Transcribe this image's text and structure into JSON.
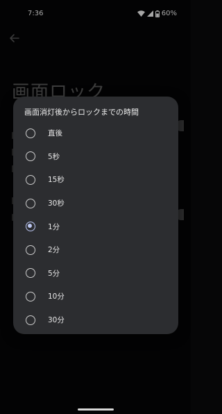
{
  "status_bar": {
    "time": "7:36",
    "battery": "60%",
    "icons": [
      "wifi-icon",
      "cell-signal-icon",
      "battery-icon"
    ]
  },
  "page": {
    "back_icon": "arrow-left-icon",
    "title": "画面ロック"
  },
  "dialog": {
    "title": "画面消灯後からロックまでの時間",
    "options": [
      {
        "label": "直後",
        "selected": false
      },
      {
        "label": "5秒",
        "selected": false
      },
      {
        "label": "15秒",
        "selected": false
      },
      {
        "label": "30秒",
        "selected": false
      },
      {
        "label": "1分",
        "selected": true
      },
      {
        "label": "2分",
        "selected": false
      },
      {
        "label": "5分",
        "selected": false
      },
      {
        "label": "10分",
        "selected": false
      },
      {
        "label": "30分",
        "selected": false
      }
    ],
    "accent_color": "#bcc7f2"
  }
}
